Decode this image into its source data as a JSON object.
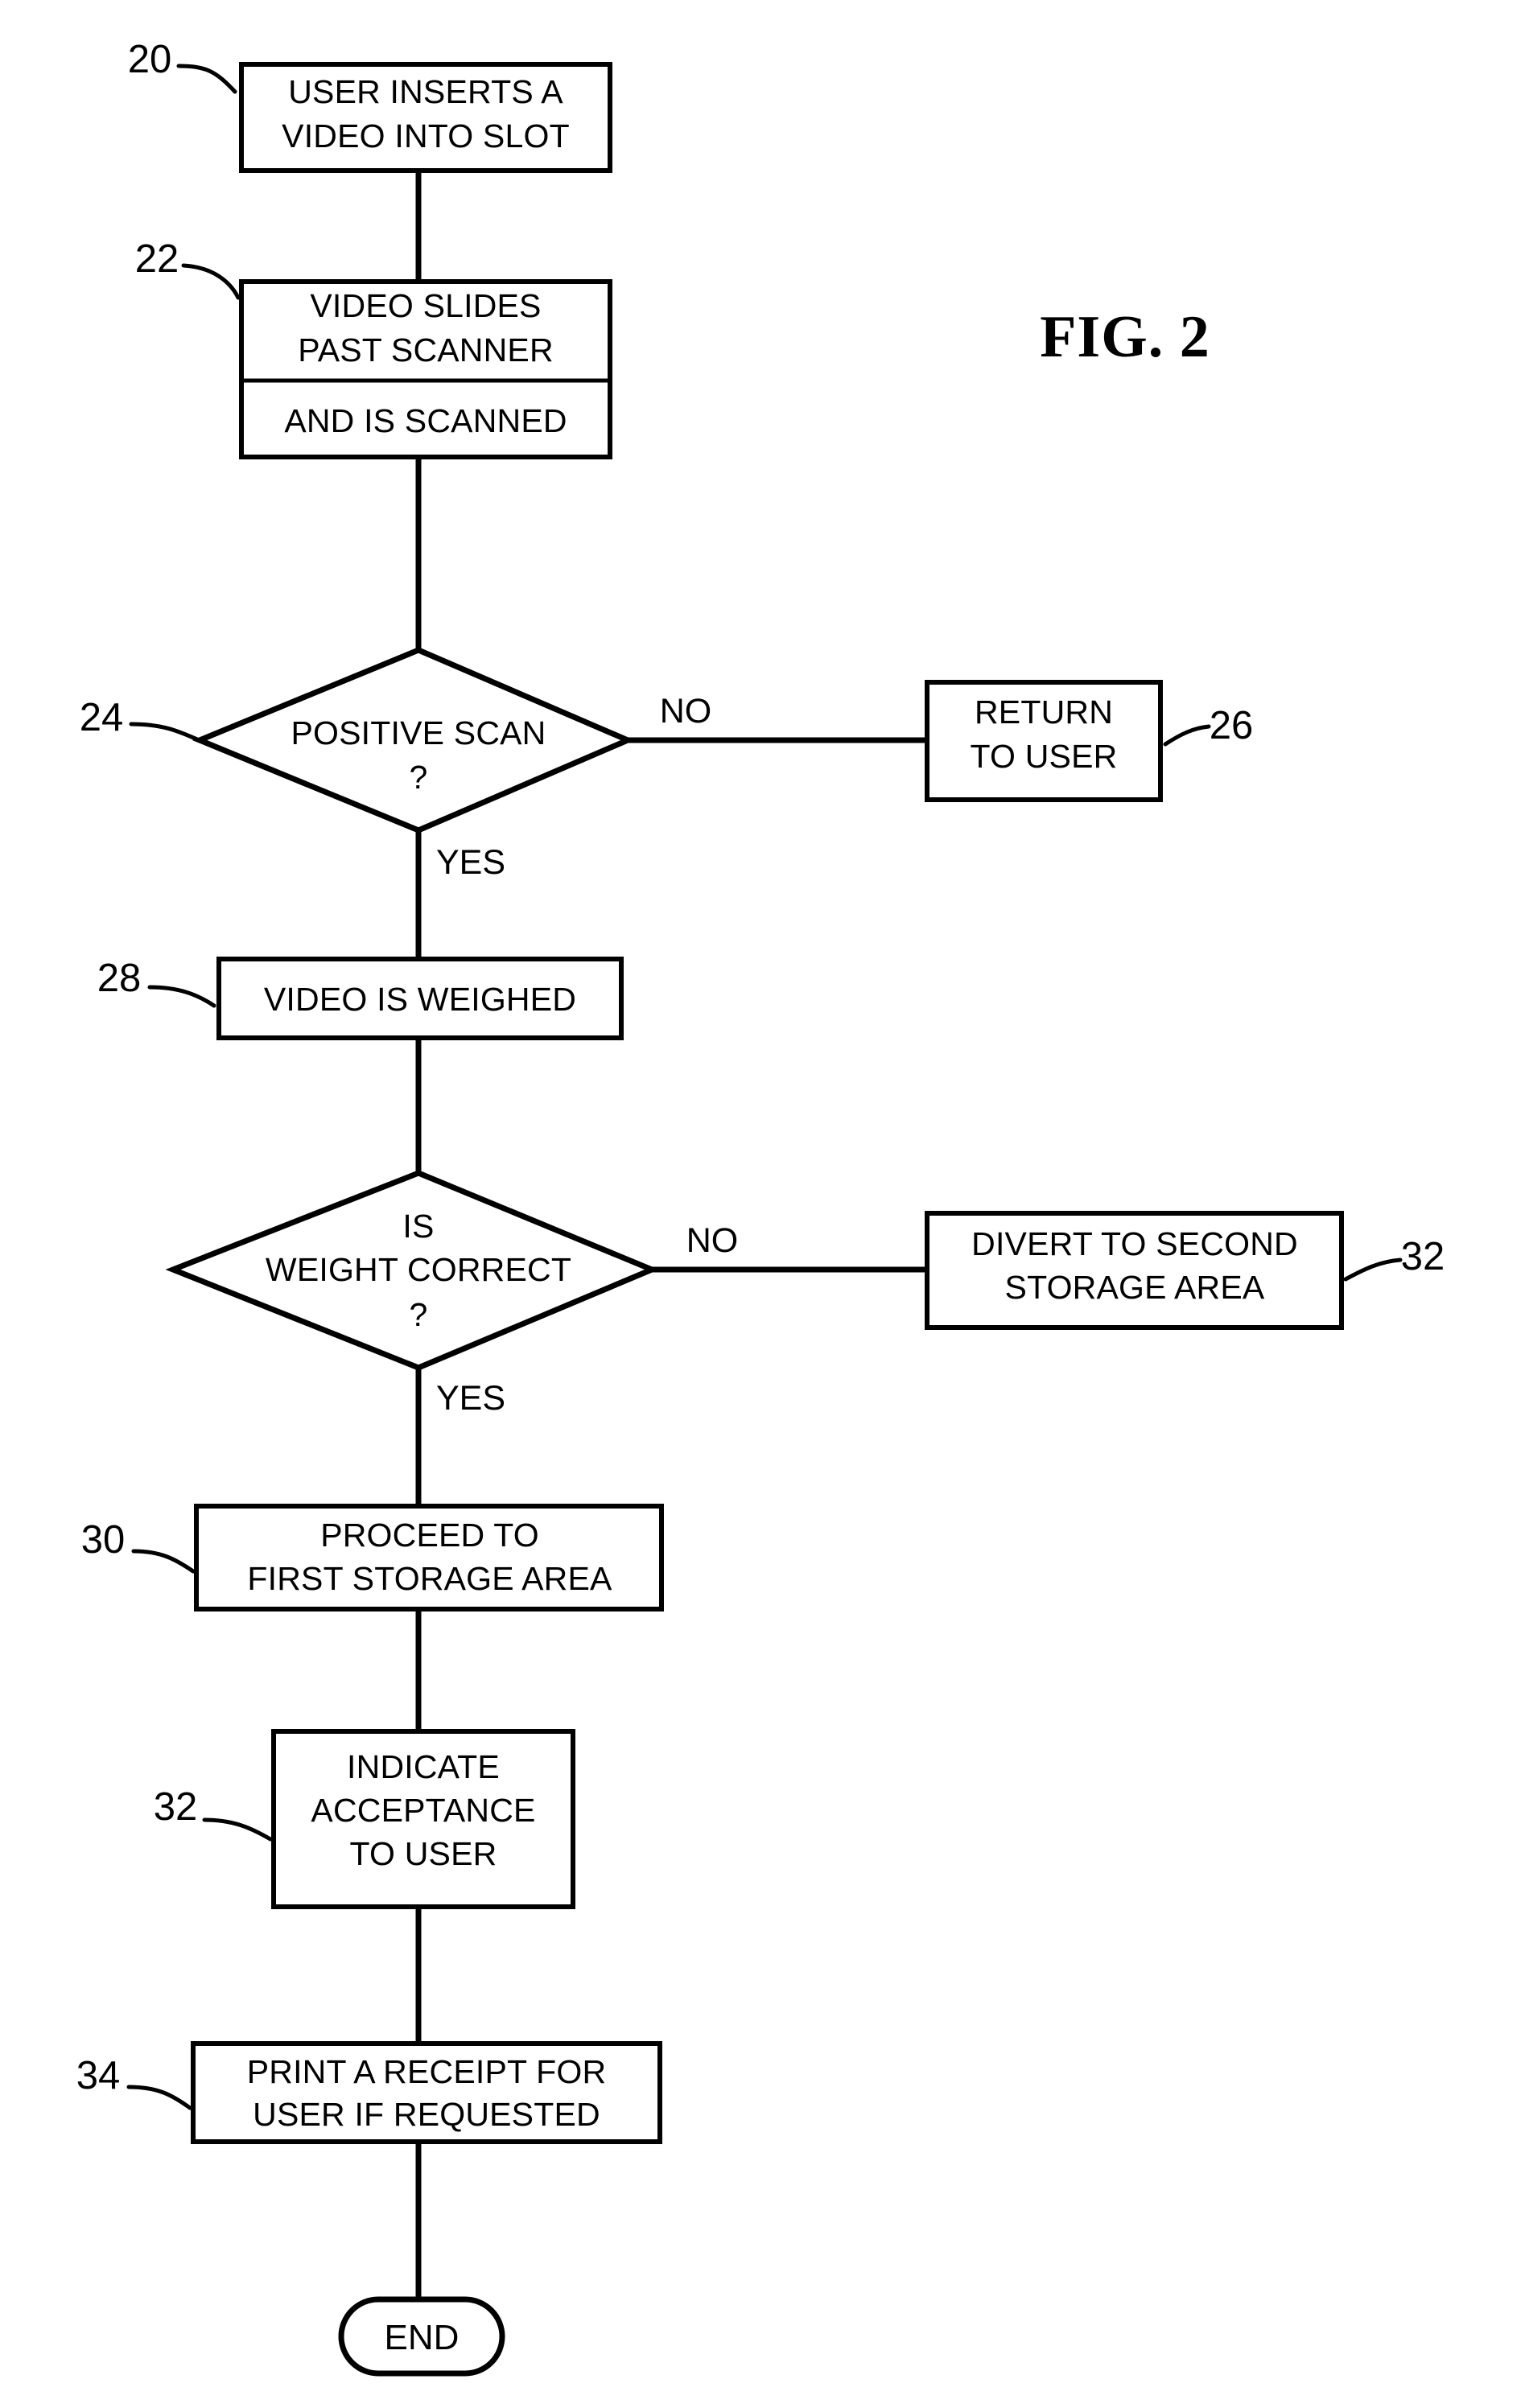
{
  "figure": {
    "title": "FIG. 2",
    "type": "flowchart",
    "description": "Patent flowchart for video return machine process"
  },
  "nodes": [
    {
      "id": "n20",
      "ref": "20",
      "shape": "process",
      "lines": [
        "USER INSERTS A",
        "VIDEO INTO SLOT"
      ]
    },
    {
      "id": "n22",
      "ref": "22",
      "shape": "process-divided",
      "lines": [
        "VIDEO SLIDES",
        "PAST SCANNER"
      ],
      "lines_lower": [
        "AND IS SCANNED"
      ]
    },
    {
      "id": "n24",
      "ref": "24",
      "shape": "decision",
      "lines": [
        "POSITIVE SCAN",
        "?"
      ]
    },
    {
      "id": "n26",
      "ref": "26",
      "shape": "process",
      "lines": [
        "RETURN",
        "TO USER"
      ]
    },
    {
      "id": "n28",
      "ref": "28",
      "shape": "process",
      "lines": [
        "VIDEO IS WEIGHED"
      ]
    },
    {
      "id": "n_weight",
      "ref": "",
      "shape": "decision",
      "lines": [
        "IS",
        "WEIGHT CORRECT",
        "?"
      ]
    },
    {
      "id": "n32a",
      "ref": "32",
      "shape": "process",
      "lines": [
        "DIVERT TO SECOND",
        "STORAGE AREA"
      ]
    },
    {
      "id": "n30",
      "ref": "30",
      "shape": "process",
      "lines": [
        "PROCEED TO",
        "FIRST STORAGE AREA"
      ]
    },
    {
      "id": "n32b",
      "ref": "32",
      "shape": "process",
      "lines": [
        "INDICATE",
        "ACCEPTANCE",
        "TO USER"
      ]
    },
    {
      "id": "n34",
      "ref": "34",
      "shape": "process",
      "lines": [
        "PRINT A RECEIPT FOR",
        "USER IF REQUESTED"
      ]
    },
    {
      "id": "n_end",
      "ref": "",
      "shape": "terminator",
      "lines": [
        "END"
      ]
    }
  ],
  "edge_labels": {
    "scan_no": "NO",
    "scan_yes": "YES",
    "weight_no": "NO",
    "weight_yes": "YES"
  },
  "text": {
    "n20_l1": "USER INSERTS A",
    "n20_l2": "VIDEO INTO SLOT",
    "n22_l1": "VIDEO SLIDES",
    "n22_l2": "PAST SCANNER",
    "n22_l3": "AND IS SCANNED",
    "n24_l1": "POSITIVE SCAN",
    "n24_l2": "?",
    "n26_l1": "RETURN",
    "n26_l2": "TO USER",
    "n28_l1": "VIDEO IS WEIGHED",
    "nw_l1": "IS",
    "nw_l2": "WEIGHT CORRECT",
    "nw_l3": "?",
    "n32a_l1": "DIVERT TO SECOND",
    "n32a_l2": "STORAGE AREA",
    "n30_l1": "PROCEED TO",
    "n30_l2": "FIRST STORAGE AREA",
    "n32b_l1": "INDICATE",
    "n32b_l2": "ACCEPTANCE",
    "n32b_l3": "TO USER",
    "n34_l1": "PRINT A RECEIPT FOR",
    "n34_l2": "USER IF REQUESTED",
    "end_l1": "END"
  },
  "refs": {
    "r20": "20",
    "r22": "22",
    "r24": "24",
    "r26": "26",
    "r28": "28",
    "r32a": "32",
    "r30": "30",
    "r32b": "32",
    "r34": "34"
  },
  "colors": {
    "stroke": "#000000",
    "background": "#ffffff"
  }
}
